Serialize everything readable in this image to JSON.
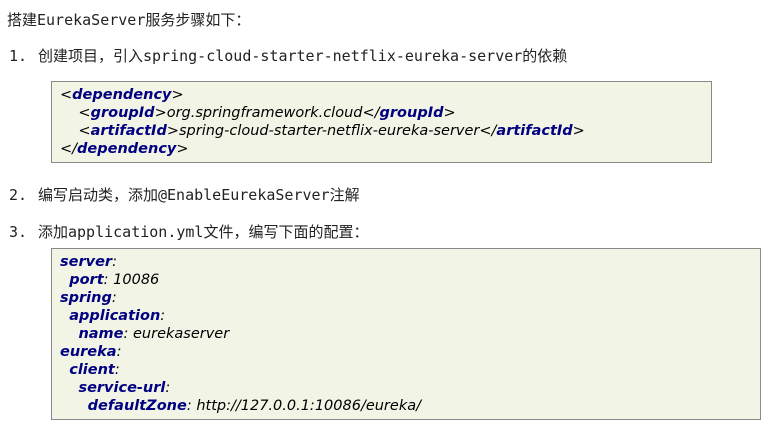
{
  "intro": "搭建EurekaServer服务步骤如下：",
  "steps": [
    {
      "num": "1.",
      "text": "创建项目，引入spring-cloud-starter-netflix-eureka-server的依赖"
    },
    {
      "num": "2.",
      "text": "编写启动类，添加@EnableEurekaServer注解"
    },
    {
      "num": "3.",
      "text": "添加application.yml文件，编写下面的配置："
    }
  ],
  "maven_block": {
    "open_tag": "dependency",
    "group_tag": "groupId",
    "group_value": "org.springframework.cloud",
    "artifact_tag": "artifactId",
    "artifact_value": "spring-cloud-starter-netflix-eureka-server",
    "close_tag": "dependency"
  },
  "yaml_block": {
    "server_key": "server",
    "port_key": "port",
    "port_value": "10086",
    "spring_key": "spring",
    "application_key": "application",
    "name_key": "name",
    "name_value": "eurekaserver",
    "eureka_key": "eureka",
    "client_key": "client",
    "service_url_key": "service-url",
    "default_zone_key": "defaultZone",
    "default_zone_value": "http://127.0.0.1:10086/eureka/"
  }
}
